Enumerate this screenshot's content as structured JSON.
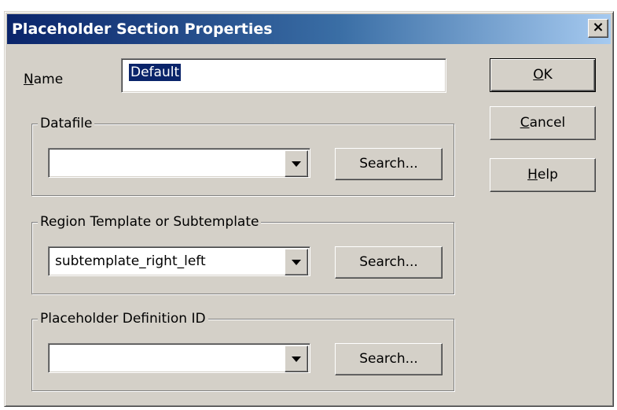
{
  "window": {
    "title": "Placeholder Section Properties",
    "close_glyph": "×"
  },
  "name_field": {
    "label_mnemonic": "N",
    "label_rest": "ame",
    "value": "Default"
  },
  "buttons": {
    "ok_mnemonic": "O",
    "ok_rest": "K",
    "cancel_mnemonic": "C",
    "cancel_rest": "ancel",
    "help_mnemonic": "H",
    "help_rest": "elp"
  },
  "groups": [
    {
      "title": "Datafile",
      "value": "",
      "search_label": "Search..."
    },
    {
      "title": "Region Template or Subtemplate",
      "value": "subtemplate_right_left",
      "search_label": "Search..."
    },
    {
      "title": "Placeholder Definition ID",
      "value": "",
      "search_label": "Search..."
    }
  ],
  "colors": {
    "dialog_bg": "#d4d0c8",
    "titlebar_start": "#0a246a",
    "titlebar_end": "#a6caf0",
    "selection": "#0a246a"
  },
  "icons": {
    "close": "close-icon",
    "dropdown": "chevron-down-icon"
  }
}
